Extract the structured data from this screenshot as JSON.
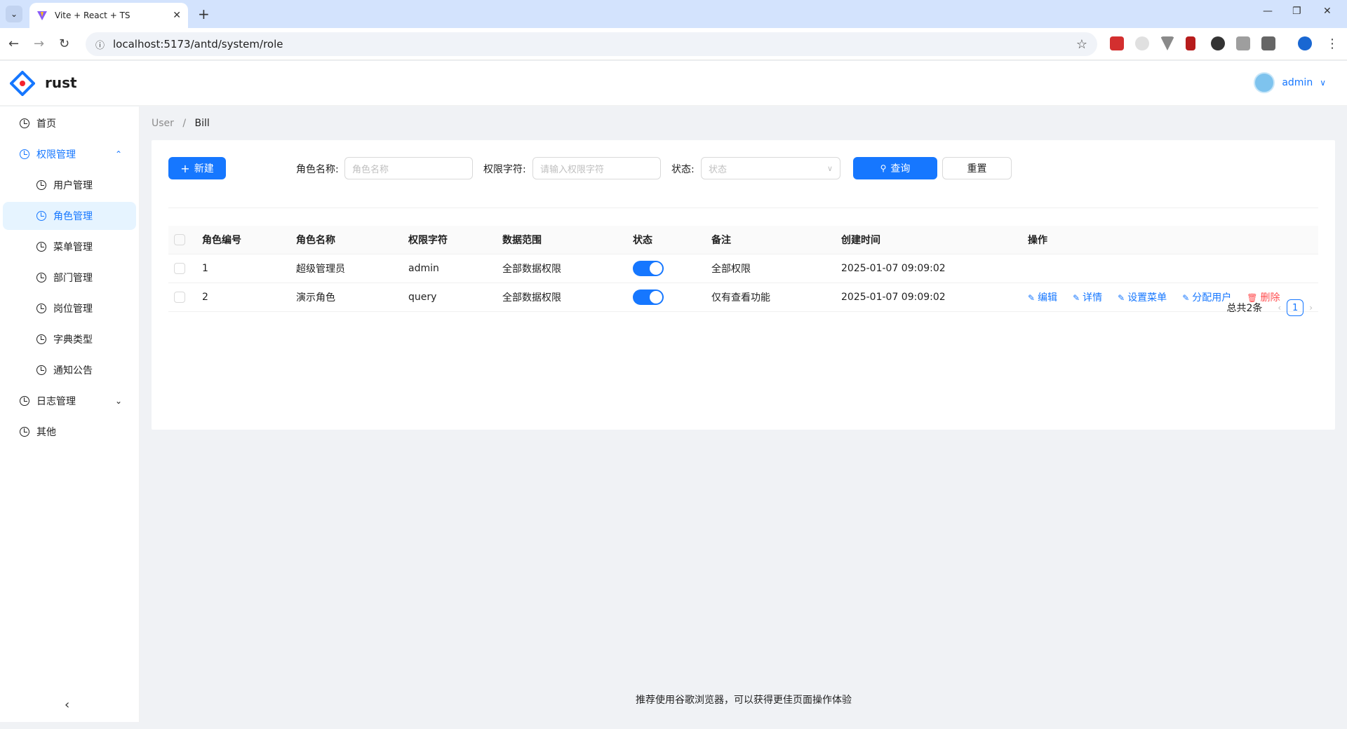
{
  "browser": {
    "tab_title": "Vite + React + TS",
    "url": "localhost:5173/antd/system/role"
  },
  "header": {
    "brand": "rust",
    "username": "admin"
  },
  "sidebar": {
    "items": [
      {
        "label": "首页"
      },
      {
        "label": "权限管理"
      },
      {
        "label": "用户管理"
      },
      {
        "label": "角色管理"
      },
      {
        "label": "菜单管理"
      },
      {
        "label": "部门管理"
      },
      {
        "label": "岗位管理"
      },
      {
        "label": "字典类型"
      },
      {
        "label": "通知公告"
      },
      {
        "label": "日志管理"
      },
      {
        "label": "其他"
      }
    ]
  },
  "breadcrumb": {
    "parent": "User",
    "sep": "/",
    "current": "Bill"
  },
  "toolbar": {
    "new_label": "新建",
    "role_name_label": "角色名称:",
    "role_name_placeholder": "角色名称",
    "role_key_label": "权限字符:",
    "role_key_placeholder": "请输入权限字符",
    "status_label": "状态:",
    "status_placeholder": "状态",
    "search_label": "查询",
    "reset_label": "重置"
  },
  "table": {
    "headers": [
      "角色编号",
      "角色名称",
      "权限字符",
      "数据范围",
      "状态",
      "备注",
      "创建时间",
      "操作"
    ],
    "rows": [
      {
        "id": "1",
        "name": "超级管理员",
        "key": "admin",
        "scope": "全部数据权限",
        "status": true,
        "remark": "全部权限",
        "created": "2025-01-07 09:09:02"
      },
      {
        "id": "2",
        "name": "演示角色",
        "key": "query",
        "scope": "全部数据权限",
        "status": true,
        "remark": "仅有查看功能",
        "created": "2025-01-07 09:09:02"
      }
    ],
    "actions": {
      "edit": "编辑",
      "detail": "详情",
      "set_menu": "设置菜单",
      "assign_user": "分配用户",
      "delete": "删除"
    }
  },
  "pagination": {
    "total": "总共2条",
    "page": "1"
  },
  "footer": {
    "text": "推荐使用谷歌浏览器，可以获得更佳页面操作体验"
  },
  "colors": {
    "primary": "#1677ff",
    "danger": "#ff4d4f"
  }
}
